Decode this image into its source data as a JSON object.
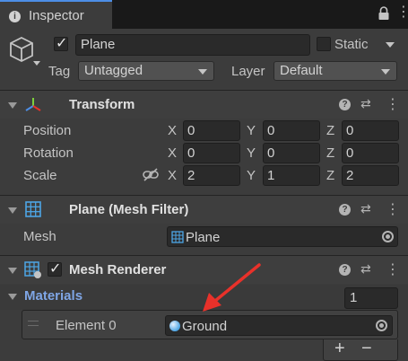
{
  "tab": {
    "title": "Inspector",
    "icon": "info-icon",
    "lock_icon": "lock-icon",
    "menu_icon": "kebab-menu-icon"
  },
  "object": {
    "name": "Plane",
    "active": true,
    "static_label": "Static",
    "static": false,
    "tag_label": "Tag",
    "tag_value": "Untagged",
    "layer_label": "Layer",
    "layer_value": "Default",
    "icon": "gameobject-cube-icon"
  },
  "transform": {
    "title": "Transform",
    "position": {
      "label": "Position",
      "x": "0",
      "y": "0",
      "z": "0"
    },
    "rotation": {
      "label": "Rotation",
      "x": "0",
      "y": "0",
      "z": "0"
    },
    "scale": {
      "label": "Scale",
      "x": "2",
      "y": "1",
      "z": "2"
    },
    "axis": {
      "x": "X",
      "y": "Y",
      "z": "Z"
    }
  },
  "mesh_filter": {
    "title": "Plane (Mesh Filter)",
    "mesh_label": "Mesh",
    "mesh_value": "Plane"
  },
  "mesh_renderer": {
    "title": "Mesh Renderer",
    "enabled": true,
    "materials_label": "Materials",
    "materials_count": "1",
    "element_label": "Element 0",
    "element_value": "Ground",
    "add": "+",
    "remove": "−"
  },
  "colors": {
    "accent": "#4d8ee6",
    "materials_label": "#7fa6e6",
    "arrow": "#e8312a"
  }
}
